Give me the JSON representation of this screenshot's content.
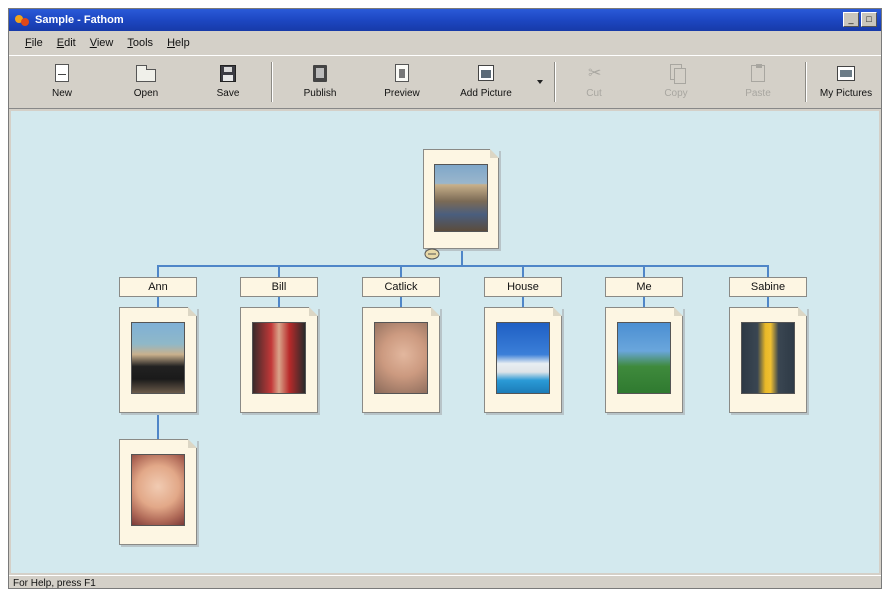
{
  "window": {
    "title": "Sample - Fathom",
    "controls": {
      "minimize": "_",
      "maximize": "□",
      "close": "×"
    }
  },
  "menu": {
    "items": [
      {
        "first": "F",
        "rest": "ile"
      },
      {
        "first": "E",
        "rest": "dit"
      },
      {
        "first": "V",
        "rest": "iew"
      },
      {
        "first": "T",
        "rest": "ools"
      },
      {
        "first": "H",
        "rest": "elp"
      }
    ]
  },
  "toolbar": {
    "buttons": [
      {
        "label": "New",
        "icon": "new-page-icon",
        "enabled": true
      },
      {
        "label": "Open",
        "icon": "folder-icon",
        "enabled": true
      },
      {
        "label": "Save",
        "icon": "disk-icon",
        "enabled": true
      },
      {
        "label": "Publish",
        "icon": "book-icon",
        "enabled": true
      },
      {
        "label": "Preview",
        "icon": "preview-icon",
        "enabled": true
      },
      {
        "label": "Add Picture",
        "icon": "picture-icon",
        "enabled": true
      },
      {
        "label": "Cut",
        "icon": "scissors-icon",
        "enabled": false
      },
      {
        "label": "Copy",
        "icon": "copy-icon",
        "enabled": false
      },
      {
        "label": "Paste",
        "icon": "paste-icon",
        "enabled": false
      },
      {
        "label": "My Pictures",
        "icon": "my-pictures-icon",
        "enabled": true
      }
    ]
  },
  "tree": {
    "root_photo": "group-at-building-photo",
    "categories": [
      {
        "label": "Ann",
        "photos": [
          "woman-with-black-dog-photo",
          "smiling-woman-portrait-photo"
        ]
      },
      {
        "label": "Bill",
        "photos": [
          "man-in-red-jacket-photo"
        ]
      },
      {
        "label": "Catlick",
        "photos": [
          "cat-closeup-photo"
        ]
      },
      {
        "label": "House",
        "photos": [
          "house-by-pool-photo"
        ]
      },
      {
        "label": "Me",
        "photos": [
          "person-on-lawn-photo"
        ]
      },
      {
        "label": "Sabine",
        "photos": [
          "child-in-yellow-dress-photo"
        ]
      }
    ],
    "line_color": "#4f86c8",
    "canvas_color": "#d3e9ee"
  },
  "status": {
    "text": "For Help, press F1"
  }
}
